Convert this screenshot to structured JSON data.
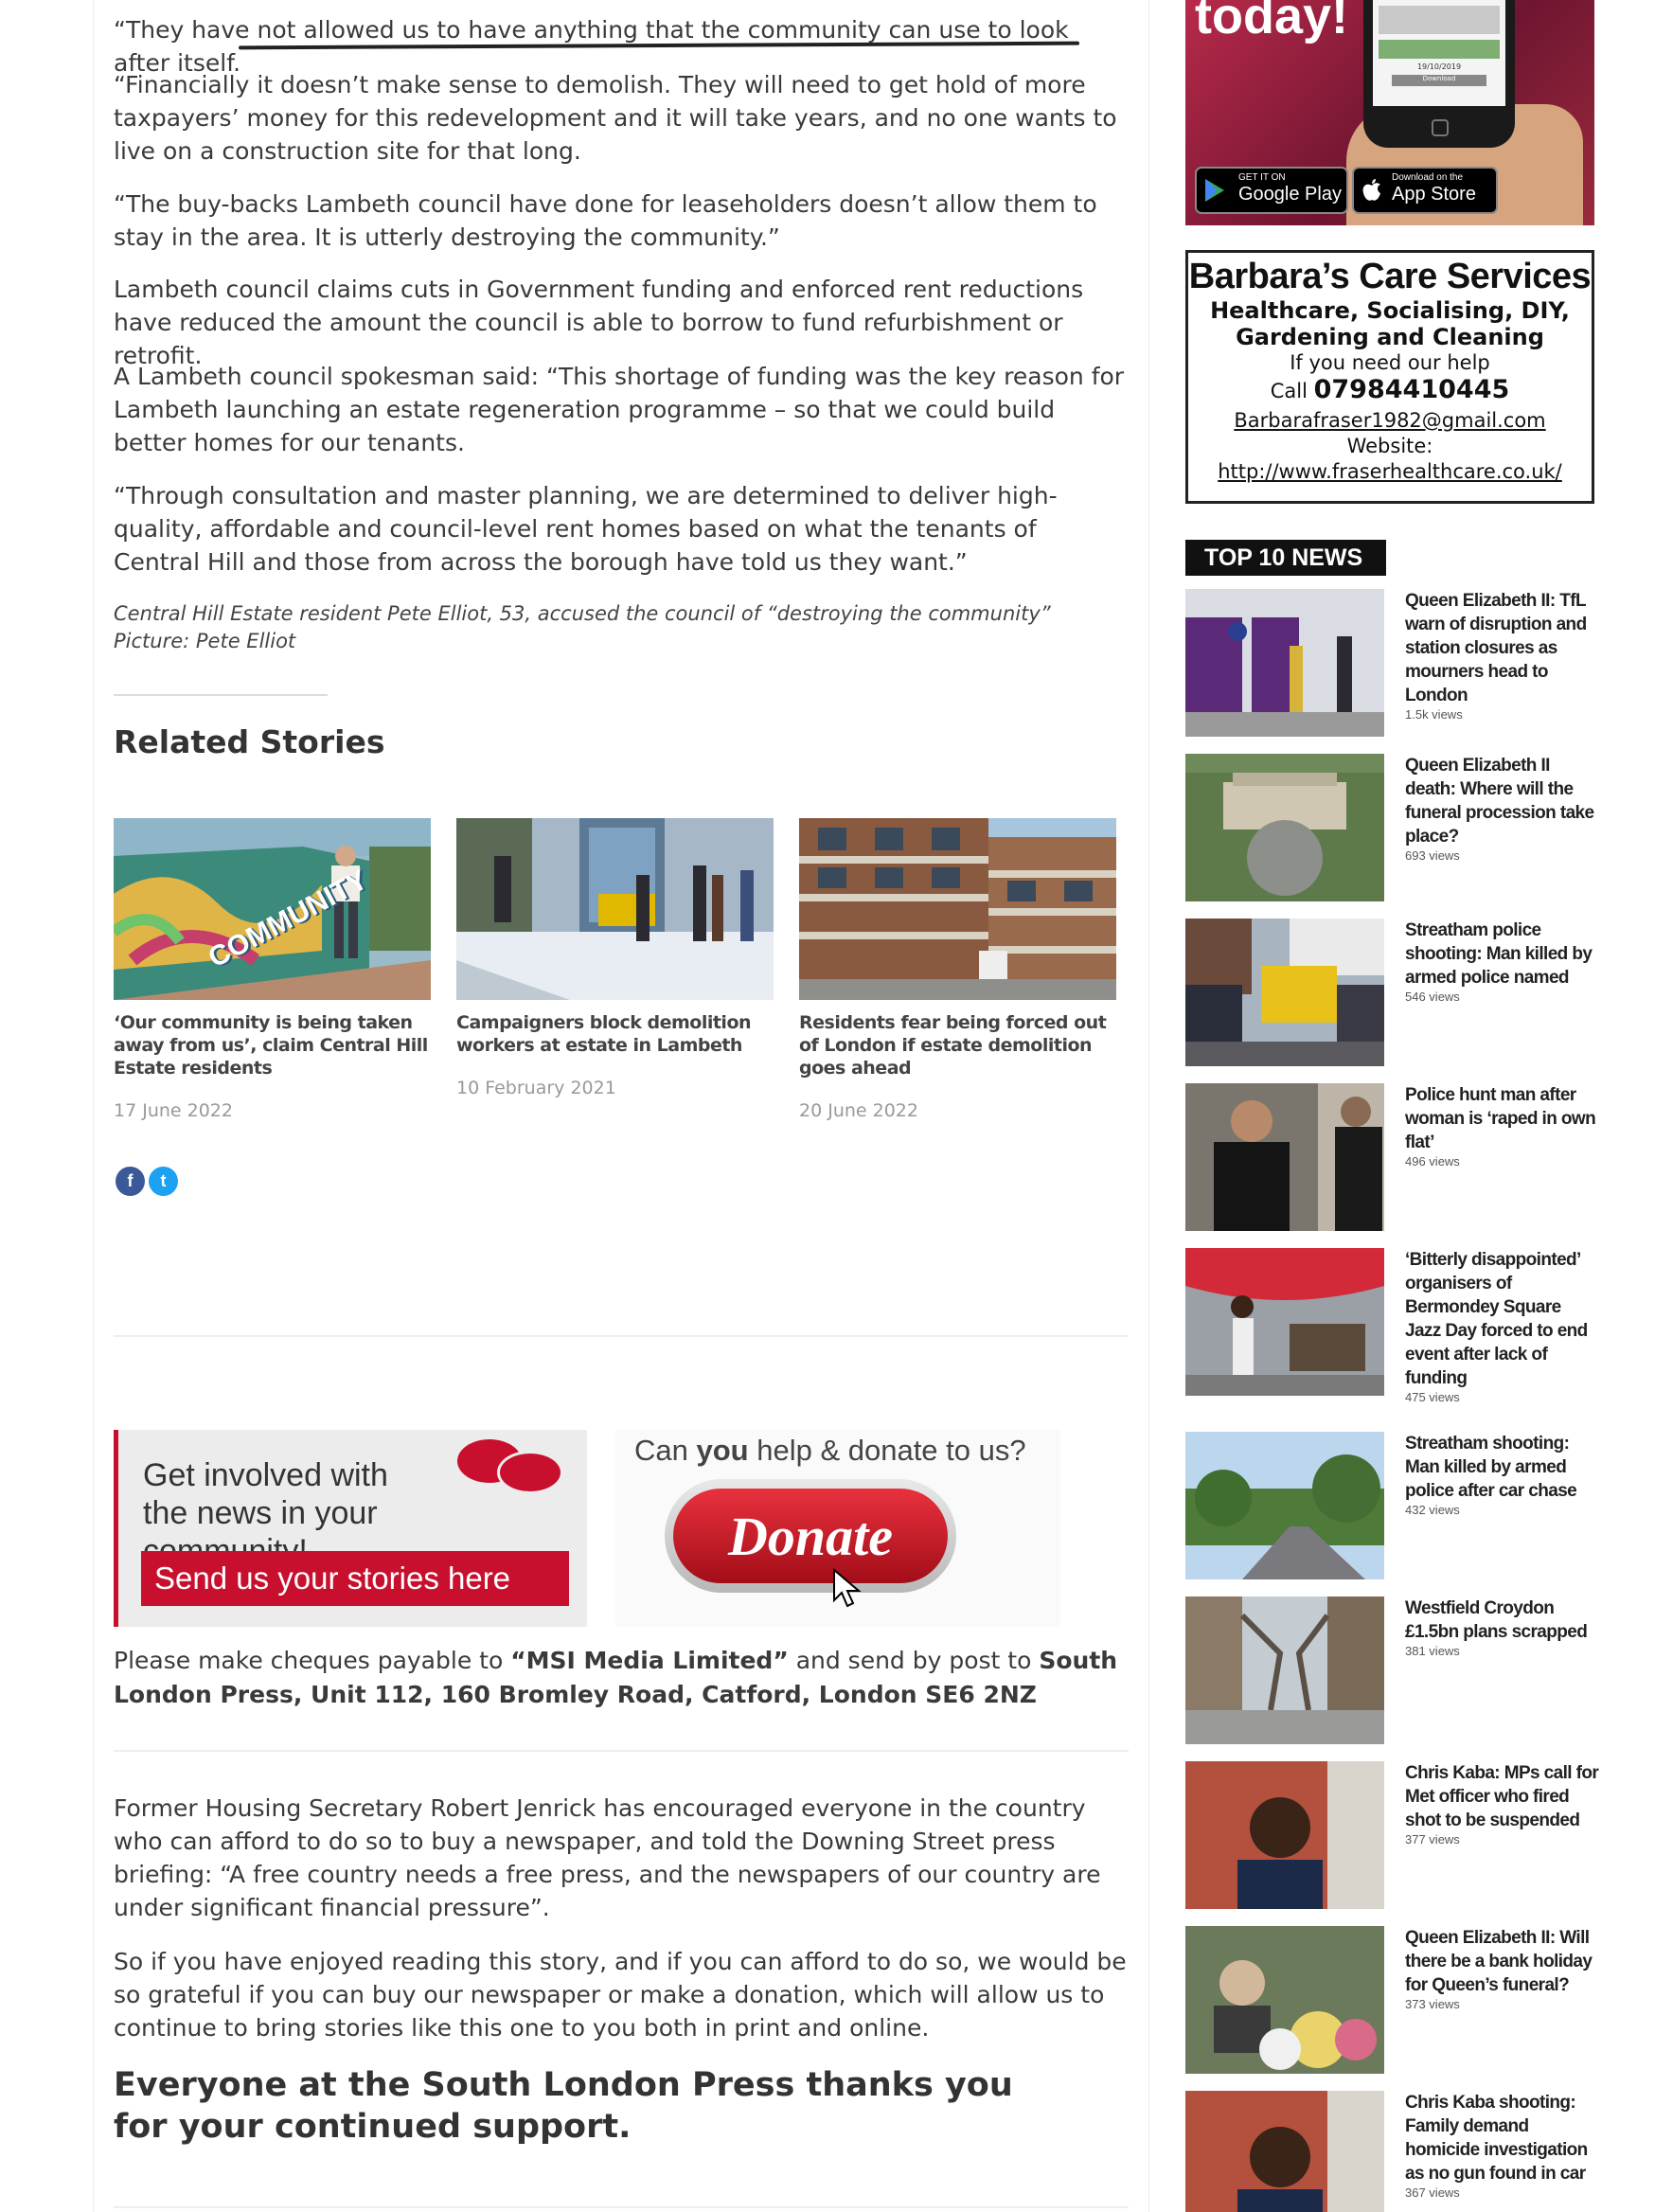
{
  "article": {
    "para1": "“They have not allowed us to have anything that the community can use to look after itself.",
    "para2": "“Financially it doesn’t make sense to demolish. They will need to get hold of more taxpayers’ money for this redevelopment and it will take years, and no one wants to live on a construction site for that long.",
    "para3": "“The buy-backs Lambeth council have done for leaseholders doesn’t allow them to stay in the area. It is utterly destroying the community.”",
    "para4": "Lambeth council claims cuts in Government funding and enforced rent reductions have reduced the amount the council is able to borrow to fund refurbishment or retrofit.",
    "para5": "A Lambeth council spokesman said: “This shortage of funding was the key reason for Lambeth launching an estate regeneration programme – so that we could build better homes for our tenants.",
    "para6": "“Through consultation and master planning, we are determined to deliver high-quality, affordable and council-level rent homes based on what the tenants of Central Hill and those from across the borough have told us they want.”",
    "caption": "Central Hill Estate resident Pete Elliot, 53, accused the council of “destroying the community” Picture: Pete Elliot"
  },
  "related": {
    "heading": "Related Stories",
    "stories": [
      {
        "title": "‘Our community is being taken away from us’, claim Central Hill Estate residents",
        "date": "17 June 2022",
        "mural_text": "COMMUNITY"
      },
      {
        "title": "Campaigners block demolition workers at estate in Lambeth",
        "date": "10 February 2021"
      },
      {
        "title": "Residents fear being forced out of London if estate demolition goes ahead",
        "date": "20 June 2022"
      }
    ]
  },
  "social": {
    "facebook": "f",
    "twitter": "t"
  },
  "banner": {
    "involved": "Get involved with the news in your community!",
    "send": "Send us your stories here",
    "ask_pre": "Can ",
    "ask_bold": "you",
    "ask_post": " help & donate to us?",
    "donate": "Donate"
  },
  "cheque": {
    "t1": "Please make cheques payable to ",
    "b1": "“MSI Media Limited”",
    "t2": " and send by post to ",
    "b2": "South London Press, Unit 112, 160 Bromley Road, Catford, London SE6 2NZ"
  },
  "appeal": {
    "p1": "Former Housing Secretary Robert Jenrick has encouraged everyone in the country who can afford to do so to buy a newspaper, and told the Downing Street press briefing: “A free country needs a free press, and the newspapers of our country are under significant financial pressure”.",
    "p2": "So if you have enjoyed reading this story, and if you can afford to do so, we would be so grateful if you can buy our newspaper or make a donation, which will allow us to continue to bring stories like this one to you both in print and online.",
    "closing": "Everyone at the South London Press thanks you for your continued support."
  },
  "app_ad": {
    "today": "today!",
    "google_small": "GET IT ON",
    "google_big": "Google Play",
    "apple_small": "Download on the",
    "apple_big": "App Store",
    "screen_date": "19/10/2019",
    "screen_btn": "Download"
  },
  "barbara": {
    "name": "Barbara’s Care Services",
    "services": "Healthcare, Socialising, DIY, Gardening and Cleaning",
    "need": "If you need our help",
    "call_label": "Call",
    "phone": "07984410445",
    "email": "Barbarafraser1982@gmail.com",
    "website_label": "Website:",
    "website": "http://www.fraserhealthcare.co.uk/"
  },
  "top10": {
    "heading": "TOP 10 NEWS",
    "items": [
      {
        "title": "Queen Elizabeth II: TfL warn of disruption and station closures as mourners head to London",
        "views": "1.5k views"
      },
      {
        "title": "Queen Elizabeth II death: Where will the funeral procession take place?",
        "views": "693 views"
      },
      {
        "title": "Streatham police shooting: Man killed by armed police named",
        "views": "546 views"
      },
      {
        "title": "Police hunt man after woman is ‘raped in own flat’",
        "views": "496 views"
      },
      {
        "title": "‘Bitterly disappointed’ organisers of Bermondey Square Jazz Day forced to end event after lack of funding",
        "views": "475 views"
      },
      {
        "title": "Streatham shooting: Man killed by armed police after car chase",
        "views": "432 views"
      },
      {
        "title": "Westfield Croydon £1.5bn plans scrapped",
        "views": "381 views"
      },
      {
        "title": "Chris Kaba: MPs call for Met officer who fired shot to be suspended",
        "views": "377 views"
      },
      {
        "title": "Queen Elizabeth II: Will there be a bank holiday for Queen’s funeral?",
        "views": "373 views"
      },
      {
        "title": "Chris Kaba shooting: Family demand homicide investigation as no gun found in car",
        "views": "367 views"
      }
    ]
  }
}
